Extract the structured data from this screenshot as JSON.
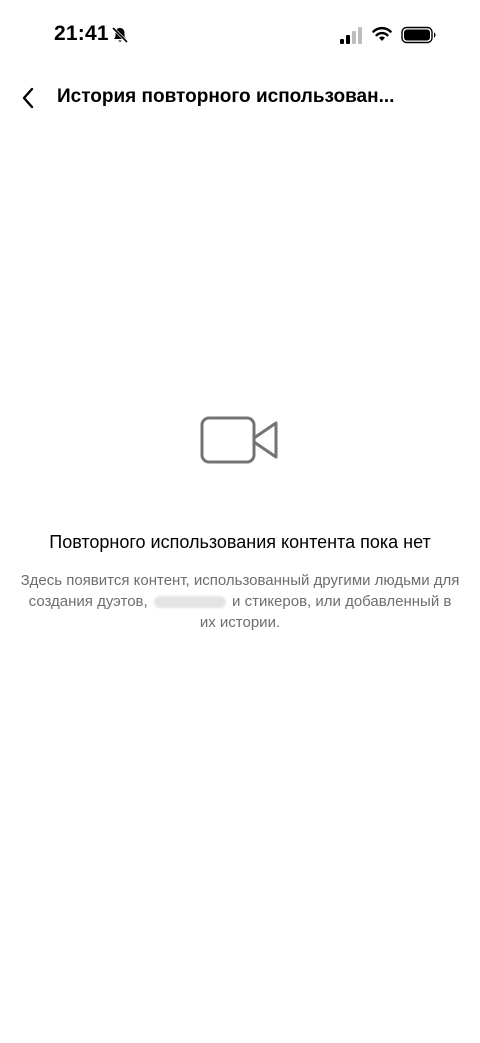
{
  "status_bar": {
    "time": "21:41",
    "icons": [
      "bell-slash-icon",
      "signal-icon",
      "wifi-icon",
      "battery-icon"
    ]
  },
  "header": {
    "back_icon": "chevron-left-icon",
    "title": "История повторного использован..."
  },
  "empty_state": {
    "icon": "video-camera-icon",
    "title": "Повторного использования контента пока нет",
    "description_part1": "Здесь появится контент, использованный другими людьми для создания дуэтов,",
    "description_part2": "и стикеров, или добавленный в их истории."
  },
  "colors": {
    "background": "#ffffff",
    "text_primary": "#000000",
    "text_secondary": "#6e6e6e",
    "icon_gray": "#737373"
  }
}
